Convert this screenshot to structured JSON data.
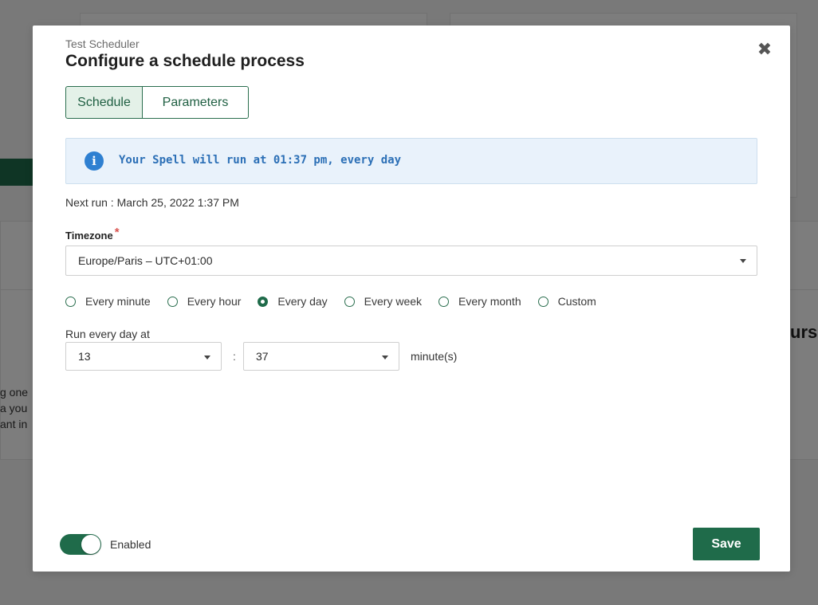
{
  "background": {
    "snippet_lines": [
      "g one",
      "a you",
      "ant in"
    ],
    "right_title_fragment": "urs"
  },
  "modal": {
    "subtitle": "Test Scheduler",
    "title": "Configure a schedule process",
    "close_icon": "close-icon",
    "tabs": [
      {
        "label": "Schedule",
        "active": true
      },
      {
        "label": "Parameters",
        "active": false
      }
    ],
    "info": {
      "icon": "info-icon",
      "text": "Your Spell will run at 01:37 pm, every day"
    },
    "next_run": "Next run : March 25, 2022 1:37 PM",
    "timezone": {
      "label": "Timezone",
      "required_mark": "*",
      "value": "Europe/Paris – UTC+01:00"
    },
    "frequency_options": [
      {
        "label": "Every minute",
        "checked": false
      },
      {
        "label": "Every hour",
        "checked": false
      },
      {
        "label": "Every day",
        "checked": true
      },
      {
        "label": "Every week",
        "checked": false
      },
      {
        "label": "Every month",
        "checked": false
      },
      {
        "label": "Custom",
        "checked": false
      }
    ],
    "run_at": {
      "label": "Run every day at",
      "hour": "13",
      "separator": ":",
      "minute": "37",
      "unit": "minute(s)"
    },
    "enabled": {
      "label": "Enabled",
      "on": true
    },
    "save_label": "Save"
  },
  "colors": {
    "primary": "#1f6b4a",
    "info_bg": "#e9f2fb",
    "info_text": "#2b6fb6",
    "required": "#d9534f"
  }
}
